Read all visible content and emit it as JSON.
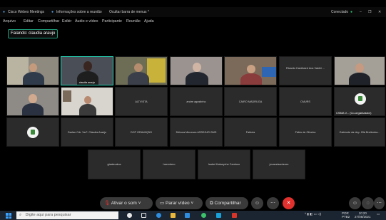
{
  "titlebar": {
    "app": "Cisco Webex Meetings",
    "meeting_info": "Informações sobre a reunião",
    "hide_bar": "Ocultar barra de menus ^",
    "connected": "Conectado"
  },
  "menu": [
    "Arquivo",
    "Editar",
    "Compartilhar",
    "Exibir",
    "Áudio e vídeo",
    "Participante",
    "Reunião",
    "Ajuda"
  ],
  "speaking": "Falando: claudia araujo",
  "grid": {
    "row1": [
      {
        "name": "",
        "video": true
      },
      {
        "name": "claudia araujo",
        "video": true,
        "active": true
      },
      {
        "name": "",
        "video": true
      },
      {
        "name": "",
        "video": true
      },
      {
        "name": "",
        "video": true
      },
      {
        "name": "Ricardo Hardbaert Aos Valdiri ...",
        "video": false
      },
      {
        "name": "",
        "video": true
      }
    ],
    "row2": [
      {
        "name": "",
        "video": true
      },
      {
        "name": "",
        "video": true
      },
      {
        "name": "ALTVISTA",
        "video": false
      },
      {
        "name": "andre agostinho",
        "video": false
      },
      {
        "name": "CAIRO MADRUGA",
        "video": false
      },
      {
        "name": "CMURS",
        "video": false
      },
      {
        "name": "CSMA V... (Co-organizador)",
        "video": false,
        "logo": true
      }
    ],
    "row3": [
      {
        "name": "",
        "video": false,
        "logo": true
      },
      {
        "name": "Darlan Cdr. Ver². Cláudia Araújo",
        "video": false
      },
      {
        "name": "DCP GRAVAÇÃO",
        "video": false
      },
      {
        "name": "Débora Meneses ASSEJUR-SMS",
        "video": false
      },
      {
        "name": "Fabiola",
        "video": false
      },
      {
        "name": "Fábio de Oliveira",
        "video": false
      },
      {
        "name": "Gabinete da dep. Zilá Breitenba...",
        "video": false
      }
    ],
    "row4": [
      {
        "name": "gisalecalua",
        "video": false
      },
      {
        "name": "hsembero",
        "video": false
      },
      {
        "name": "Isabel Kalaeyche Cardoso",
        "video": false
      },
      {
        "name": "jovanstsanizzes",
        "video": false
      }
    ]
  },
  "controls": {
    "mute": "Ativar o som",
    "video": "Parar vídeo",
    "share": "Compartilhar"
  },
  "taskbar": {
    "search_placeholder": "Digite aqui para pesquisar",
    "lang": "POR",
    "lang2": "PTB2",
    "time": "10:20",
    "date": "27/08/2021"
  }
}
